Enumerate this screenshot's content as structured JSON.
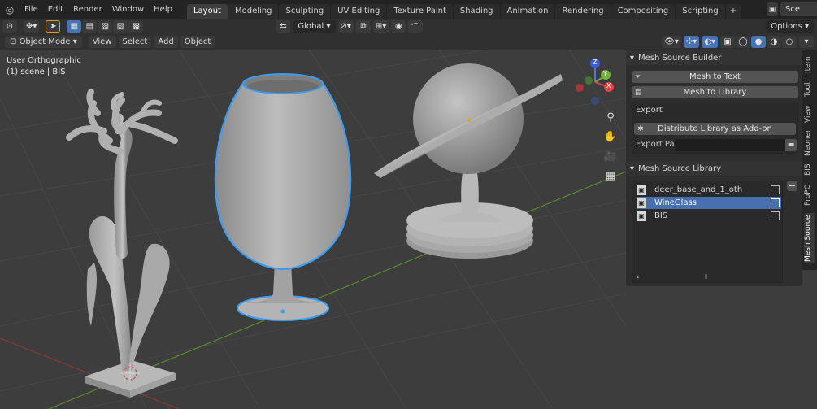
{
  "topbar": {
    "menus": [
      "File",
      "Edit",
      "Render",
      "Window",
      "Help"
    ],
    "tabs": [
      "Layout",
      "Modeling",
      "Sculpting",
      "UV Editing",
      "Texture Paint",
      "Shading",
      "Animation",
      "Rendering",
      "Compositing",
      "Scripting"
    ],
    "tab_plus": "+",
    "scene_label": "Sce"
  },
  "toolbar": {
    "orientation": "Global",
    "options": "Options"
  },
  "header": {
    "mode": "Object Mode",
    "menus": [
      "View",
      "Select",
      "Add",
      "Object"
    ]
  },
  "viewport": {
    "view_name": "User Orthographic",
    "collection": "(1) scene | BIS",
    "gizmo": {
      "x": "X",
      "y": "Y",
      "z": "Z"
    }
  },
  "builder": {
    "title": "Mesh Source Builder",
    "mesh_to_text": "Mesh to Text",
    "mesh_to_library": "Mesh to Library",
    "export_label": "Export",
    "distribute": "Distribute Library as Add-on",
    "export_path_label": "Export Pa..."
  },
  "library": {
    "title": "Mesh Source Library",
    "items": [
      "deer_base_and_1_oth",
      "WineGlass",
      "BIS"
    ],
    "selected": "WineGlass"
  },
  "sidetabs": [
    "Item",
    "Tool",
    "View",
    "Neoner",
    "BIS",
    "ProPC",
    "Mesh Source"
  ],
  "colors": {
    "accent": "#4772b3",
    "selection_outline": "#3d9cf2",
    "header_bg": "#232323",
    "viewport_bg": "#3d3d3d"
  }
}
